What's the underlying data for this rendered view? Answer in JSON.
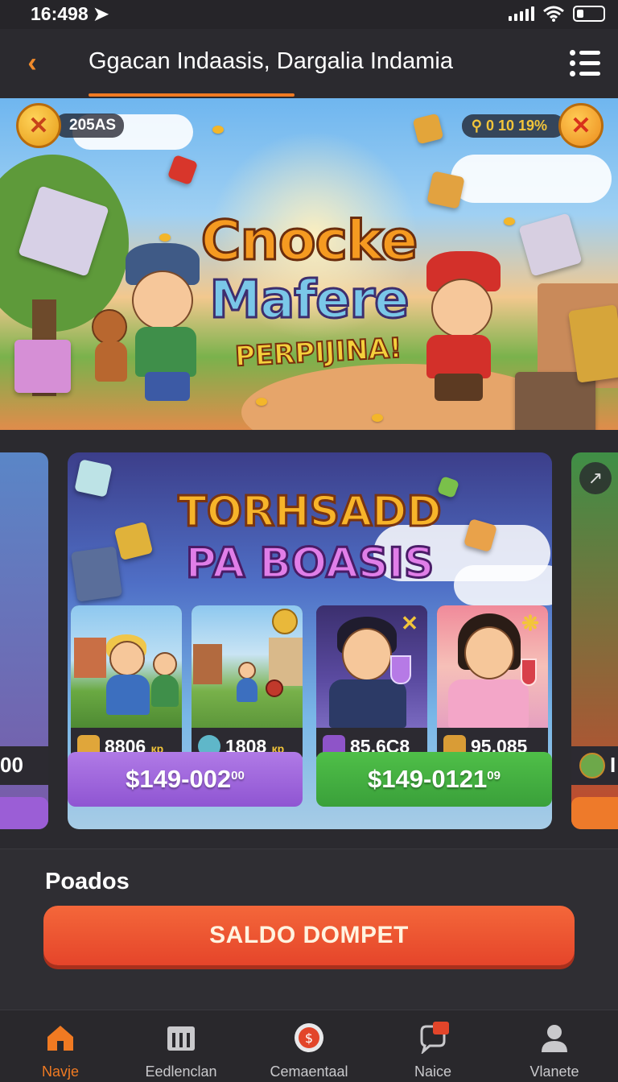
{
  "status": {
    "time": "16:498"
  },
  "header": {
    "title": "Ggacan Indaasis, Dargalia Indamia"
  },
  "hero": {
    "title_line1": "Cnocke",
    "title_line2": "Mafere",
    "title_line3": "PERPIJINA!",
    "left_badge": "205AS",
    "right_badge": "0 10 19%"
  },
  "carousel": {
    "left_card_value": "00",
    "right_card_value": "I",
    "main_card": {
      "title_line1": "TORHSADD",
      "title_line2": "PA BOASIS",
      "tiles": [
        {
          "value": "8806",
          "unit": "кр"
        },
        {
          "value": "1808",
          "unit": "кр"
        },
        {
          "value": "85,6C8",
          "unit": ""
        },
        {
          "value": "95,085",
          "unit": ""
        }
      ],
      "buttons": [
        {
          "price": "$149-002",
          "sup": "00"
        },
        {
          "price": "$149-0121",
          "sup": "09"
        }
      ]
    }
  },
  "section": {
    "label": "Poados",
    "cta": "SALDO DOMPET"
  },
  "tabs": [
    {
      "label": "Navje",
      "icon": "home-icon",
      "active": true
    },
    {
      "label": "Eedlenclan",
      "icon": "store-icon",
      "active": false
    },
    {
      "label": "Cemaentaal",
      "icon": "coin-icon",
      "active": false
    },
    {
      "label": "Naice",
      "icon": "chat-icon",
      "active": false
    },
    {
      "label": "Vlanete",
      "icon": "profile-icon",
      "active": false
    }
  ],
  "colors": {
    "accent": "#f07a22",
    "background": "#2b2a2f",
    "purple_button": "#9b5ed6",
    "green_button": "#3fad3f",
    "cta": "#ea5230"
  }
}
